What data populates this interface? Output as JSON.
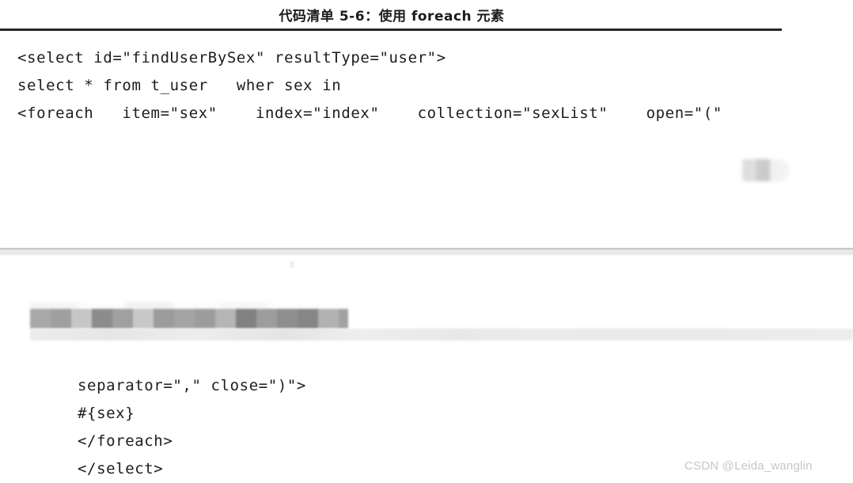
{
  "document": {
    "page_background": "#ffffff",
    "text_color": "#1d1d1f",
    "rule_color": "#26272c",
    "watermark_color": "#c6c6c6"
  },
  "upper_figure": {
    "caption": "代码清单 5-6：使用 foreach 元素",
    "code_lines": [
      "<select id=\"findUserBySex\" resultType=\"user\">",
      "select * from t_user   wher sex in",
      "<foreach   item=\"sex\"    index=\"index\"    collection=\"sexList\"    open=\"(\""
    ],
    "redacted_blob_label": "blurred-label"
  },
  "lower_figure": {
    "redacted_line_label": "mosaic-redacted-text",
    "code_lines": [
      "separator=\",\" close=\")\">",
      "#{sex}",
      "</foreach>",
      "</select>"
    ]
  },
  "watermark": {
    "text": "CSDN @Leida_wanglin"
  }
}
